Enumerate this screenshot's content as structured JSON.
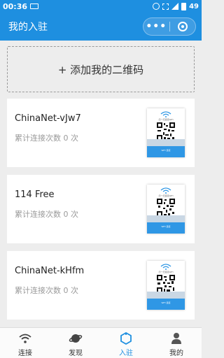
{
  "status_bar": {
    "time": "00:36",
    "battery": "49"
  },
  "header": {
    "title": "我的入驻",
    "more_label": "•••"
  },
  "add_button": {
    "label": "+ 添加我的二维码"
  },
  "networks": [
    {
      "name": "ChinaNet-vJw7",
      "count_text": "累计连接次数 0 次"
    },
    {
      "name": "114 Free",
      "count_text": "累计连接次数 0 次"
    },
    {
      "name": "ChinaNet-kHfm",
      "count_text": "累计连接次数 0 次"
    }
  ],
  "qr_card": {
    "hint": "扫一扫连接WiFi",
    "footer": "WiFi 连接"
  },
  "tabs": [
    {
      "label": "连接",
      "icon": "wifi-icon",
      "active": false
    },
    {
      "label": "发现",
      "icon": "planet-icon",
      "active": false
    },
    {
      "label": "入驻",
      "icon": "home-icon",
      "active": true
    },
    {
      "label": "我的",
      "icon": "user-icon",
      "active": false
    }
  ],
  "colors": {
    "primary": "#1e8fe0",
    "background": "#ededed",
    "muted_text": "#9a9a9a"
  }
}
